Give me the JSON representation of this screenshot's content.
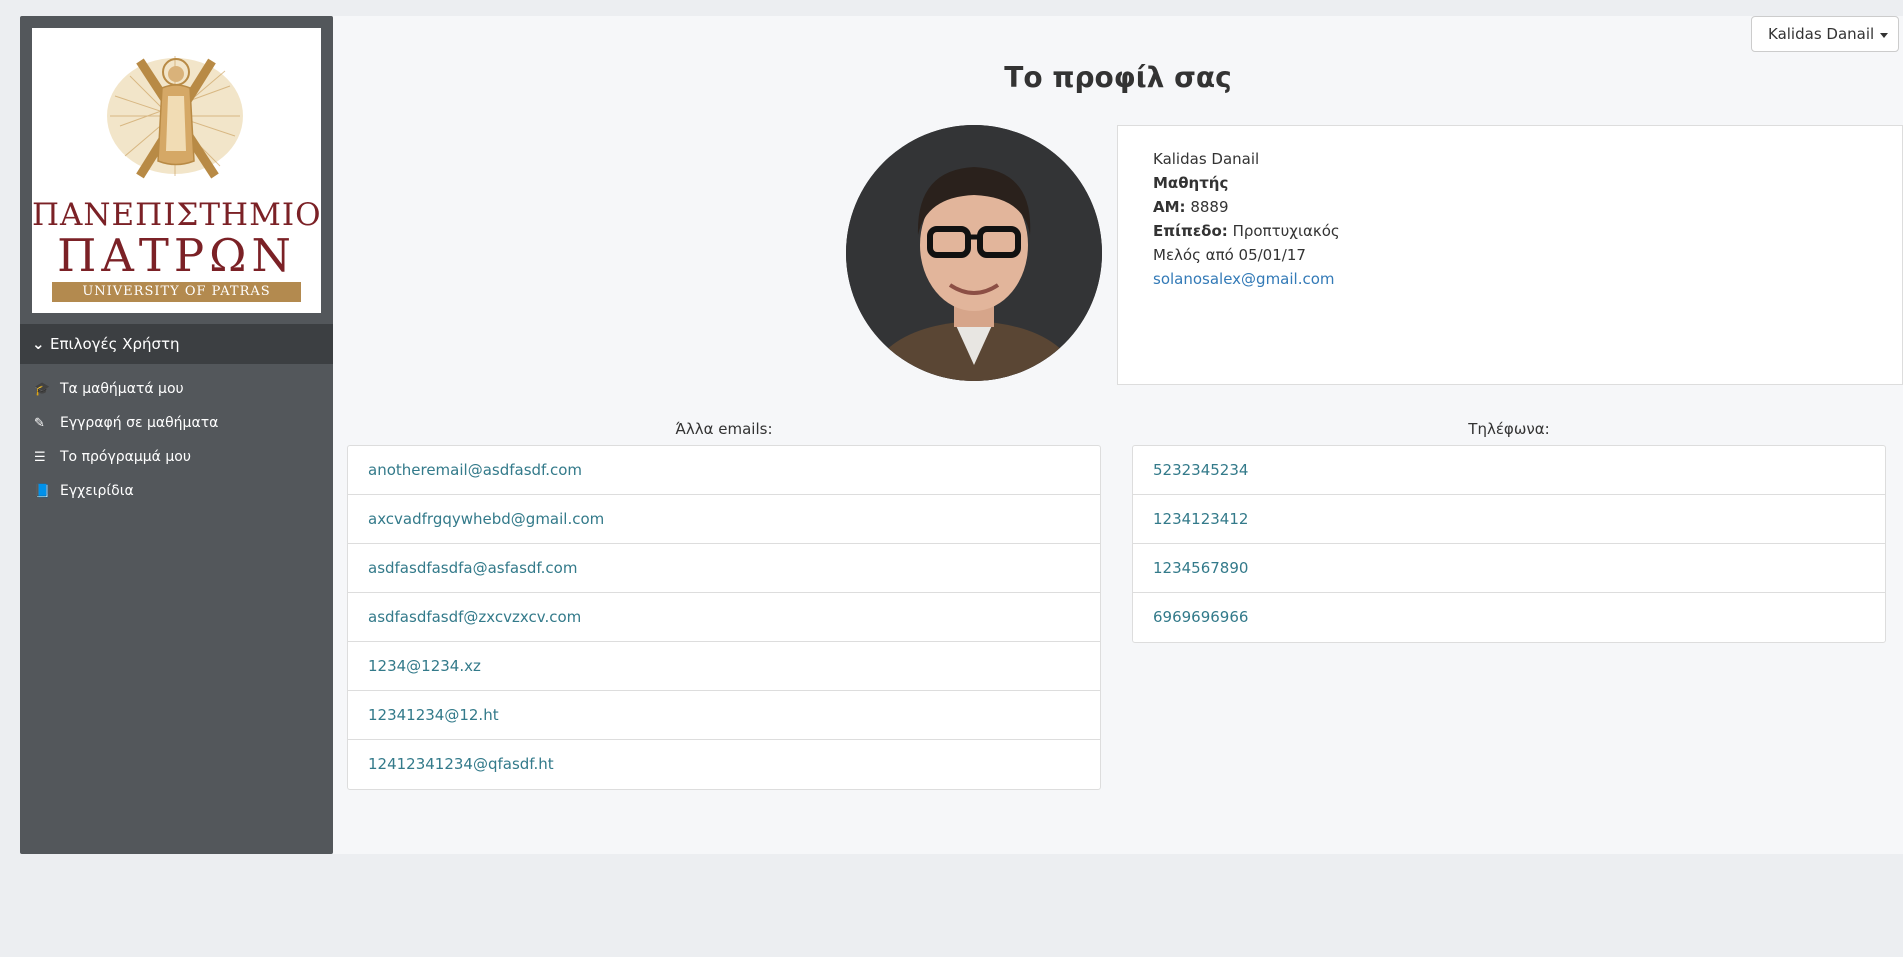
{
  "logo": {
    "line1": "ΠΑΝΕΠΙΣΤΗΜΙΟ",
    "line2": "ΠΑΤΡΩΝ",
    "line3": "UNIVERSITY OF PATRAS"
  },
  "sidebar": {
    "header": "Επιλογές Χρήστη",
    "items": [
      {
        "label": "Τα μαθήματά μου",
        "icon": "graduation-cap-icon"
      },
      {
        "label": "Εγγραφή σε μαθήματα",
        "icon": "pencil-icon"
      },
      {
        "label": "Το πρόγραμμά μου",
        "icon": "list-icon"
      },
      {
        "label": "Εγχειρίδια",
        "icon": "book-icon"
      }
    ]
  },
  "user_menu": {
    "label": "Kalidas Danail"
  },
  "page": {
    "title": "Το προφίλ σας"
  },
  "profile": {
    "name": "Kalidas Danail",
    "role": "Μαθητής",
    "am_label": "AM:",
    "am_value": "8889",
    "level_label": "Επίπεδο:",
    "level_value": "Προπτυχιακός",
    "member_since": "Μελός από 05/01/17",
    "email": "solanosalex@gmail.com"
  },
  "emails": {
    "heading": "Άλλα emails:",
    "items": [
      "anotheremail@asdfasdf.com",
      "axcvadfrgqywhebd@gmail.com",
      "asdfasdfasdfa@asfasdf.com",
      "asdfasdfasdf@zxcvzxcv.com",
      "1234@1234.xz",
      "12341234@12.ht",
      "12412341234@qfasdf.ht"
    ]
  },
  "phones": {
    "heading": "Τηλέφωνα:",
    "items": [
      "5232345234",
      "1234123412",
      "1234567890",
      "6969696966"
    ]
  },
  "colors": {
    "sidebar": "#53575b",
    "menu_header": "#3c3f42",
    "link": "#337ab7",
    "logo_red": "#7b2126",
    "logo_gold": "#b38a4f"
  }
}
